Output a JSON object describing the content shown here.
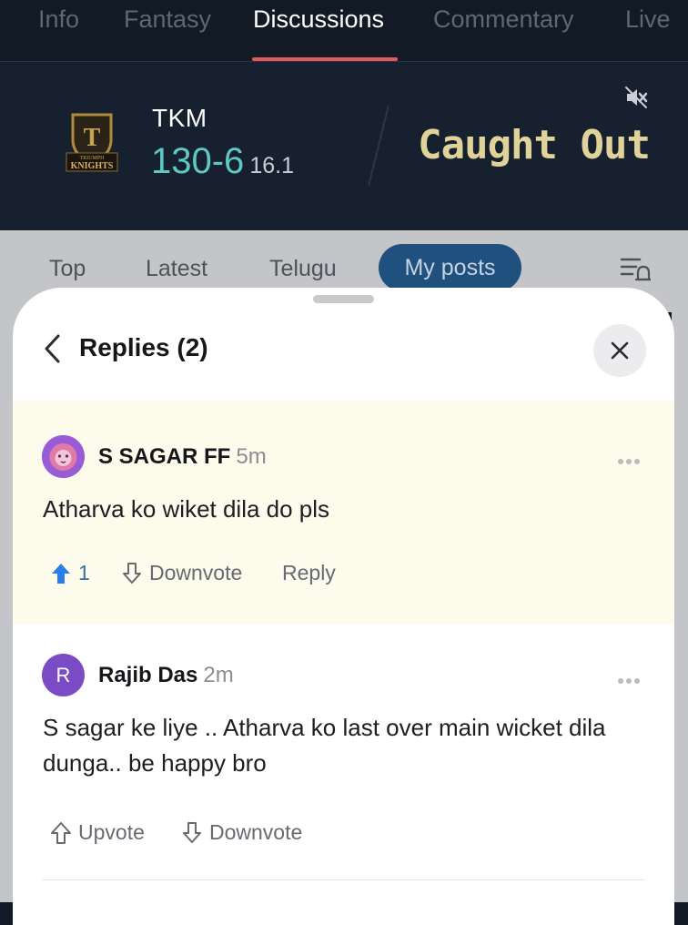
{
  "top_tabs": [
    "Info",
    "Fantasy",
    "Discussions",
    "Commentary",
    "Live"
  ],
  "active_top_tab": "Discussions",
  "match": {
    "logo_line1": "TRIUMPH",
    "logo_line2": "KNIGHTS",
    "team": "TKM",
    "score": "130-6",
    "overs": "16.1",
    "status": "Caught Out"
  },
  "filters": [
    "Top",
    "Latest",
    "Telugu",
    "My posts"
  ],
  "active_filter": "My posts",
  "sheet": {
    "title": "Replies (2)"
  },
  "replies": [
    {
      "author": "S SAGAR FF",
      "time": "5m",
      "avatar": "lion-icon",
      "text": "Atharva ko wiket dila do pls",
      "upvote_label": "1",
      "downvote_label": "Downvote",
      "reply_label": "Reply"
    },
    {
      "author": "Rajib Das",
      "time": "2m",
      "avatar_letter": "R",
      "text": "S sagar ke liye .. Atharva ko last over main wicket dila dunga.. be happy bro",
      "upvote_label": "Upvote",
      "downvote_label": "Downvote"
    }
  ],
  "colors": {
    "header_bg": "#121a26",
    "score_color": "#5ec8c4",
    "status_color": "#e0d39a",
    "active_tab_underline": "#e05a5a",
    "active_filter_bg": "#20507d",
    "upvote_active": "#2b7de9"
  }
}
